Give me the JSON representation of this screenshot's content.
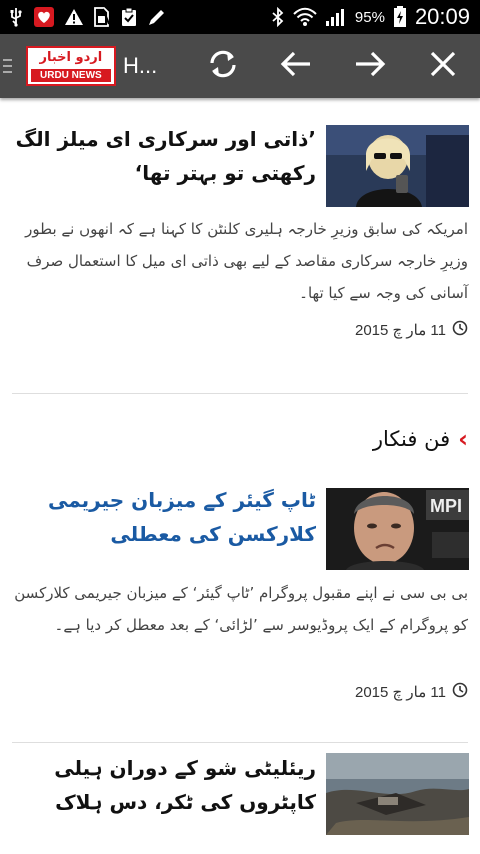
{
  "status_bar": {
    "battery": "95%",
    "time": "20:09",
    "icons": [
      "usb-icon",
      "heart-app-icon",
      "warning-icon",
      "sim-icon",
      "clipboard-icon",
      "pen-icon",
      "bluetooth-icon",
      "wifi-icon",
      "signal-icon",
      "battery-charging-icon"
    ]
  },
  "toolbar": {
    "logo_urdu": "اردو اخبار",
    "logo_en": "URDU NEWS",
    "title": "H...",
    "buttons": [
      "refresh-icon",
      "back-arrow-icon",
      "forward-arrow-icon",
      "close-icon"
    ]
  },
  "articles": [
    {
      "headline": "’ذاتی اور سرکاری ای میلز الگ رکھتی تو بہتر تھا‘",
      "summary": "امریکہ کی سابق وزیرِ خارجہ ہلیری کلنٹن کا کہنا ہے کہ انھوں نے بطور وزیرِ خارجہ سرکاری مقاصد کے لیے بھی ذاتی ای میل کا استعمال صرف آسانی کی وجہ سے کیا تھا۔",
      "date": "11 مار چ 2015"
    },
    {
      "headline": "ٹاپ گیئر کے میزبان جیریمی کلارکسن کی معطلی",
      "summary": "بی بی سی نے اپنے مقبول پروگرام ’ٹاپ گیئر‘ کے میزبان جیریمی کلارکسن کو پروگرام کے ایک پروڈیوسر سے ’لڑائی‘ کے بعد معطل کر دیا ہے۔",
      "date": "11 مار چ 2015"
    },
    {
      "headline": "ریئلیٹی شو کے دوران ہیلی کاپٹروں کی ٹکر، دس ہلاک"
    }
  ],
  "section": {
    "title": "فن فنکار",
    "chevron": "‹"
  }
}
